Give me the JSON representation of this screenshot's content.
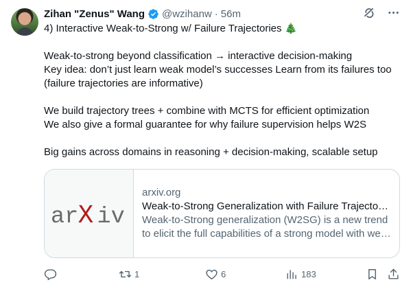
{
  "author": {
    "name": "Zihan \"Zenus\" Wang",
    "handle": "@wzihanw",
    "separator": "·",
    "time": "56m"
  },
  "tweet": {
    "lines": [
      "4) Interactive Weak-to-Strong w/ Failure Trajectories 🎄",
      "",
      "Weak-to-strong beyond classification → interactive decision-making",
      "Key idea: don’t just learn weak model’s successes Learn from its failures too (failure trajectories are informative)",
      "",
      "We build trajectory trees + combine with MCTS for efficient optimization",
      "We also give a formal guarantee for why failure supervision helps W2S",
      "",
      "Big gains across domains in reasoning + decision-making, scalable setup"
    ]
  },
  "link_card": {
    "logo_text_left": "ar",
    "logo_text_x": "X",
    "logo_text_right": "iv",
    "domain": "arxiv.org",
    "title": "Weak-to-Strong Generalization with Failure Trajectories",
    "description": "Weak-to-Strong generalization (W2SG) is a new trend to elicit the full capabilities of a strong model with weak supervision"
  },
  "actions": {
    "reply_count": "",
    "retweet_count": "1",
    "like_count": "6",
    "views_count": "183"
  },
  "colors": {
    "verified": "#1d9bf0",
    "muted": "#536471",
    "border": "#cfd9de",
    "arxiv_red": "#b31b1b",
    "arxiv_gray": "#6b6b6b"
  },
  "icons": [
    "verified-icon",
    "grok-icon",
    "more-icon",
    "reply-icon",
    "retweet-icon",
    "like-icon",
    "views-icon",
    "bookmark-icon",
    "share-icon"
  ]
}
